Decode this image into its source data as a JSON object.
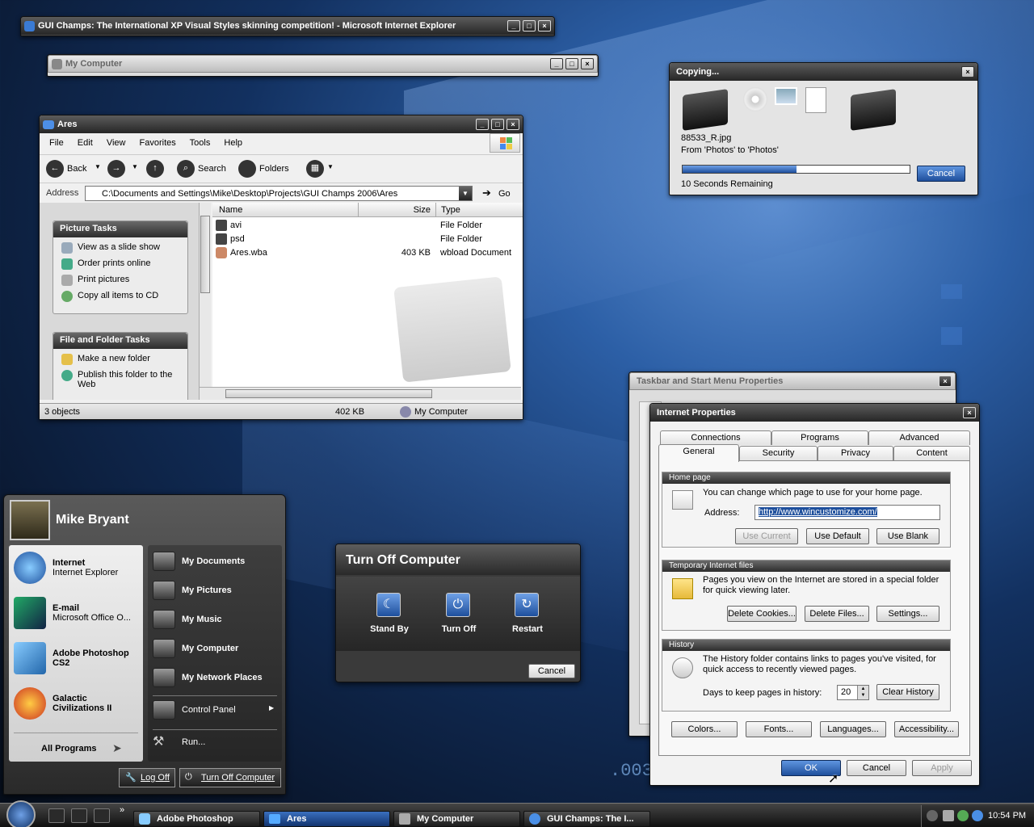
{
  "ie_window": {
    "title": "GUI Champs: The International XP Visual Styles skinning competition! - Microsoft Internet Explorer"
  },
  "mycomputer_window": {
    "title": "My Computer"
  },
  "explorer": {
    "title": "Ares",
    "menu": [
      "File",
      "Edit",
      "View",
      "Favorites",
      "Tools",
      "Help"
    ],
    "toolbar": {
      "back": "Back",
      "search": "Search",
      "folders": "Folders"
    },
    "address_label": "Address",
    "address_value": "C:\\Documents and Settings\\Mike\\Desktop\\Projects\\GUI Champs 2006\\Ares",
    "go": "Go",
    "picture_tasks": {
      "title": "Picture Tasks",
      "items": [
        "View as a slide show",
        "Order prints online",
        "Print pictures",
        "Copy all items to CD"
      ]
    },
    "file_tasks": {
      "title": "File and Folder Tasks",
      "items": [
        "Make a new folder",
        "Publish this folder to the Web"
      ]
    },
    "columns": [
      "Name",
      "Size",
      "Type"
    ],
    "files": [
      {
        "name": "avi",
        "size": "",
        "type": "File Folder"
      },
      {
        "name": "psd",
        "size": "",
        "type": "File Folder"
      },
      {
        "name": "Ares.wba",
        "size": "403 KB",
        "type": "wbload Document"
      }
    ],
    "status": {
      "objects": "3 objects",
      "size": "402 KB",
      "location": "My Computer"
    }
  },
  "copying": {
    "title": "Copying...",
    "file": "88533_R.jpg",
    "from": "From 'Photos' to 'Photos'",
    "progress": 0.5,
    "remaining": "10 Seconds Remaining",
    "cancel": "Cancel"
  },
  "taskbar_props": {
    "title": "Taskbar and Start Menu Properties"
  },
  "inet": {
    "title": "Internet Properties",
    "tabs_back": [
      "Connections",
      "Programs",
      "Advanced"
    ],
    "tabs_front": [
      "General",
      "Security",
      "Privacy",
      "Content"
    ],
    "home": {
      "title": "Home page",
      "desc": "You can change which page to use for your home page.",
      "address_label": "Address:",
      "address": "http://www.wincustomize.com/",
      "use_current": "Use Current",
      "use_default": "Use Default",
      "use_blank": "Use Blank"
    },
    "temp": {
      "title": "Temporary Internet files",
      "desc": "Pages you view on the Internet are stored in a special folder for quick viewing later.",
      "cookies": "Delete Cookies...",
      "files": "Delete Files...",
      "settings": "Settings..."
    },
    "history": {
      "title": "History",
      "desc": "The History folder contains links to pages you've visited, for quick access to recently viewed pages.",
      "days_label": "Days to keep pages in history:",
      "days": "20",
      "clear": "Clear History"
    },
    "bottom": {
      "colors": "Colors...",
      "fonts": "Fonts...",
      "languages": "Languages...",
      "accessibility": "Accessibility..."
    },
    "ok": "OK",
    "cancel": "Cancel",
    "apply": "Apply"
  },
  "start_menu": {
    "user": "Mike Bryant",
    "pinned": [
      {
        "name": "Internet",
        "sub": "Internet Explorer"
      },
      {
        "name": "E-mail",
        "sub": "Microsoft Office O..."
      },
      {
        "name": "Adobe Photoshop CS2",
        "sub": ""
      },
      {
        "name": "Galactic Civilizations II",
        "sub": ""
      }
    ],
    "all_programs": "All Programs",
    "right": [
      "My Documents",
      "My Pictures",
      "My Music",
      "My Computer",
      "My Network Places"
    ],
    "control_panel": "Control Panel",
    "run": "Run...",
    "log_off": "Log Off",
    "turn_off": "Turn Off Computer"
  },
  "turnoff": {
    "title": "Turn Off Computer",
    "stand_by": "Stand By",
    "turn_off": "Turn Off",
    "restart": "Restart",
    "cancel": "Cancel"
  },
  "taskbar": {
    "items": [
      "Adobe Photoshop",
      "Ares",
      "My Computer",
      "GUI Champs: The I..."
    ],
    "clock": "10:54 PM"
  },
  "desktop": {
    "deco": ".003"
  },
  "colors": {
    "accent": "#1e4f9c",
    "window_dark": "#2a2a2a"
  }
}
